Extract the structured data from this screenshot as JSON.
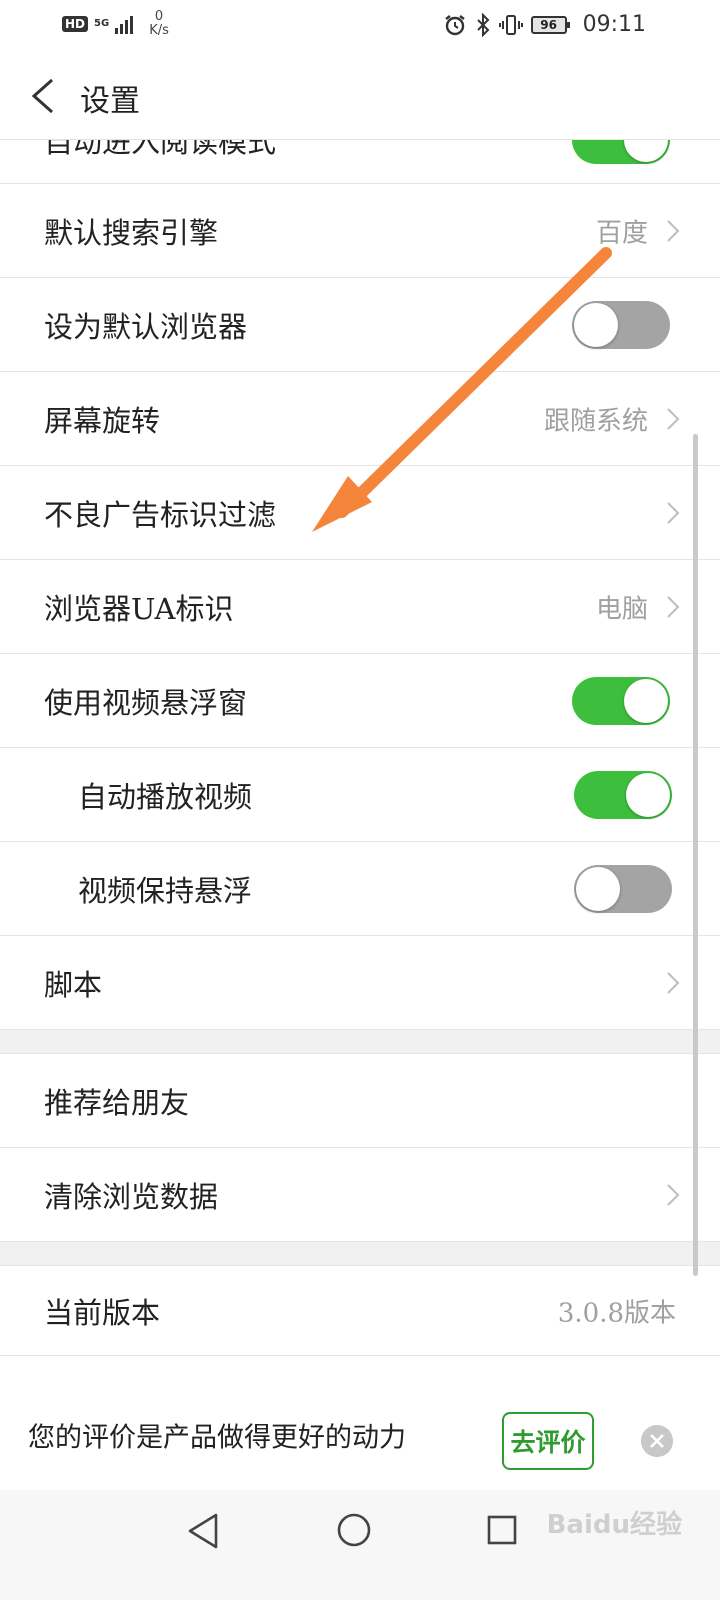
{
  "status_bar": {
    "hd": "HD",
    "network": "5G",
    "speed_value": "0",
    "speed_unit": "K/s",
    "battery": "96",
    "time": "09:11"
  },
  "header": {
    "title": "设置"
  },
  "settings": [
    {
      "label": "自动进入阅读模式",
      "type": "toggle",
      "on": true
    },
    {
      "label": "默认搜索引擎",
      "type": "link",
      "value": "百度"
    },
    {
      "label": "设为默认浏览器",
      "type": "toggle",
      "on": false
    },
    {
      "label": "屏幕旋转",
      "type": "link",
      "value": "跟随系统"
    },
    {
      "label": "不良广告标识过滤",
      "type": "link",
      "value": ""
    },
    {
      "label": "浏览器UA标识",
      "type": "link",
      "value": "电脑"
    },
    {
      "label": "使用视频悬浮窗",
      "type": "toggle",
      "on": true
    },
    {
      "label": "自动播放视频",
      "type": "toggle",
      "on": true,
      "indent": true
    },
    {
      "label": "视频保持悬浮",
      "type": "toggle",
      "on": false,
      "indent": true
    },
    {
      "label": "脚本",
      "type": "link",
      "value": ""
    }
  ],
  "other": [
    {
      "label": "推荐给朋友"
    },
    {
      "label": "清除浏览数据"
    }
  ],
  "version": {
    "label": "当前版本",
    "value": "3.0.8版本"
  },
  "rating_banner": {
    "text": "您的评价是产品做得更好的动力",
    "button": "去评价"
  },
  "watermark": "Baidu经验",
  "colors": {
    "toggle_on": "#3dbf3d",
    "toggle_off": "#a4a4a4",
    "annotation_arrow": "#f5853a",
    "rate_button": "#2e9c2e"
  }
}
